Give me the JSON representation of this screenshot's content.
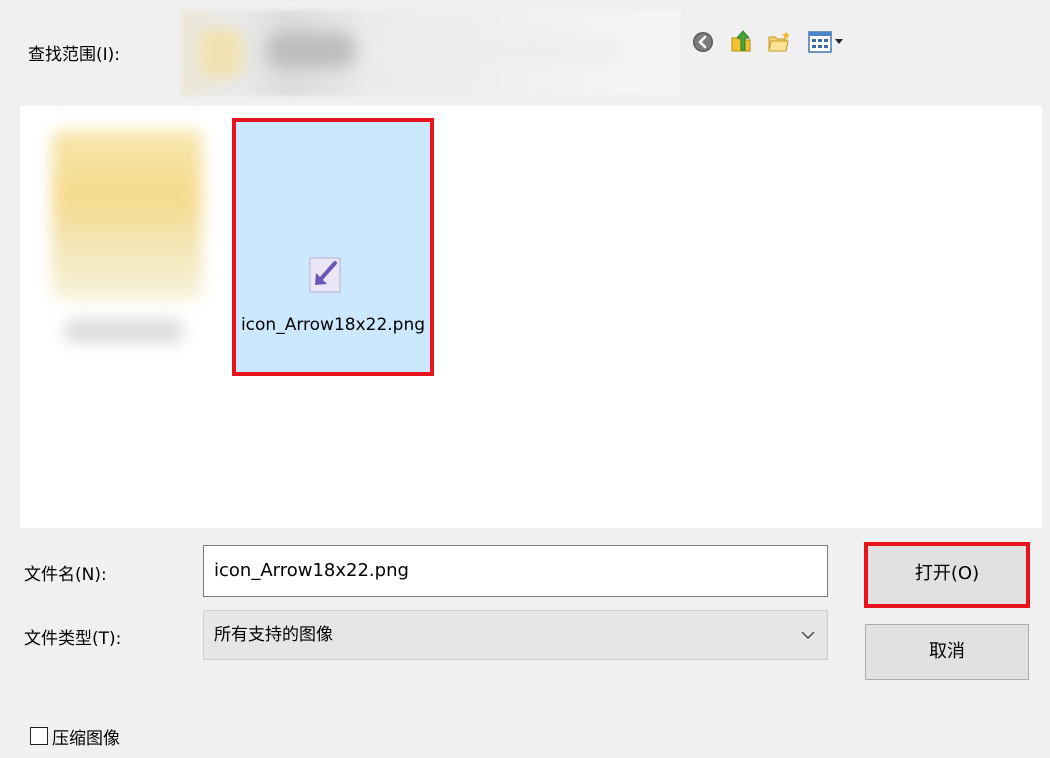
{
  "lookin": {
    "label": "查找范围(I):",
    "path": ""
  },
  "toolbar": {
    "back_icon": "back-arrow-icon",
    "up_icon": "up-folder-icon",
    "new_folder_icon": "new-folder-icon",
    "view_icon": "view-menu-icon"
  },
  "files": [
    {
      "name": "",
      "selected": false,
      "blurred": true
    },
    {
      "name": "icon_Arrow18x22.png",
      "selected": true,
      "icon": "image-file-icon"
    }
  ],
  "filename": {
    "label": "文件名(N):",
    "value": "icon_Arrow18x22.png"
  },
  "filetype": {
    "label": "文件类型(T):",
    "value": "所有支持的图像"
  },
  "buttons": {
    "open_label": "打开(O)",
    "cancel_label": "取消"
  },
  "compress": {
    "label": "压缩图像",
    "checked": false
  },
  "colors": {
    "selection": "#cce8ff",
    "highlight": "#e8141b",
    "accent": "#0078d7"
  }
}
